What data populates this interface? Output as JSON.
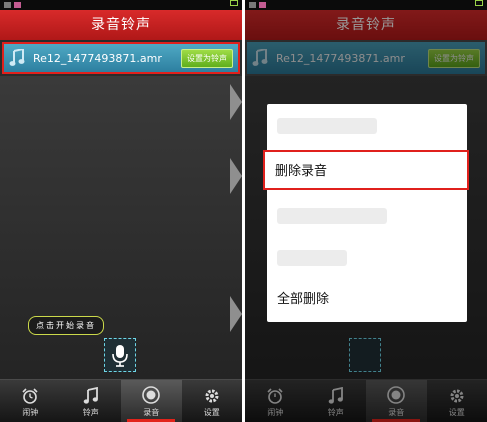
{
  "left_screen": {
    "title": "录音铃声",
    "file": {
      "name": "Re12_1477493871.amr",
      "set_button_label": "设置为铃声",
      "icon": "music-note-icon"
    },
    "hint": "点击开始录音",
    "mic_icon": "microphone-icon",
    "nav": [
      {
        "label": "闹钟",
        "icon": "alarm-clock-icon"
      },
      {
        "label": "铃声",
        "icon": "music-note-icon"
      },
      {
        "label": "录音",
        "icon": "record-icon"
      },
      {
        "label": "设置",
        "icon": "gear-icon"
      }
    ]
  },
  "right_screen": {
    "title": "录音铃声",
    "file": {
      "name": "Re12_1477493871.amr",
      "set_button_label": "设置为铃声",
      "icon": "music-note-icon"
    },
    "menu": {
      "item_1": "删除录音",
      "item_2": "全部删除"
    },
    "nav": [
      {
        "label": "闹钟",
        "icon": "alarm-clock-icon"
      },
      {
        "label": "铃声",
        "icon": "music-note-icon"
      },
      {
        "label": "录音",
        "icon": "record-icon"
      },
      {
        "label": "设置",
        "icon": "gear-icon"
      }
    ]
  },
  "colors": {
    "titlebar": "#c81f1f",
    "file_row": "#3b94b4",
    "highlight_border": "#e0201c",
    "button_green": "#7cc534",
    "nav_active": "#e2231a"
  }
}
